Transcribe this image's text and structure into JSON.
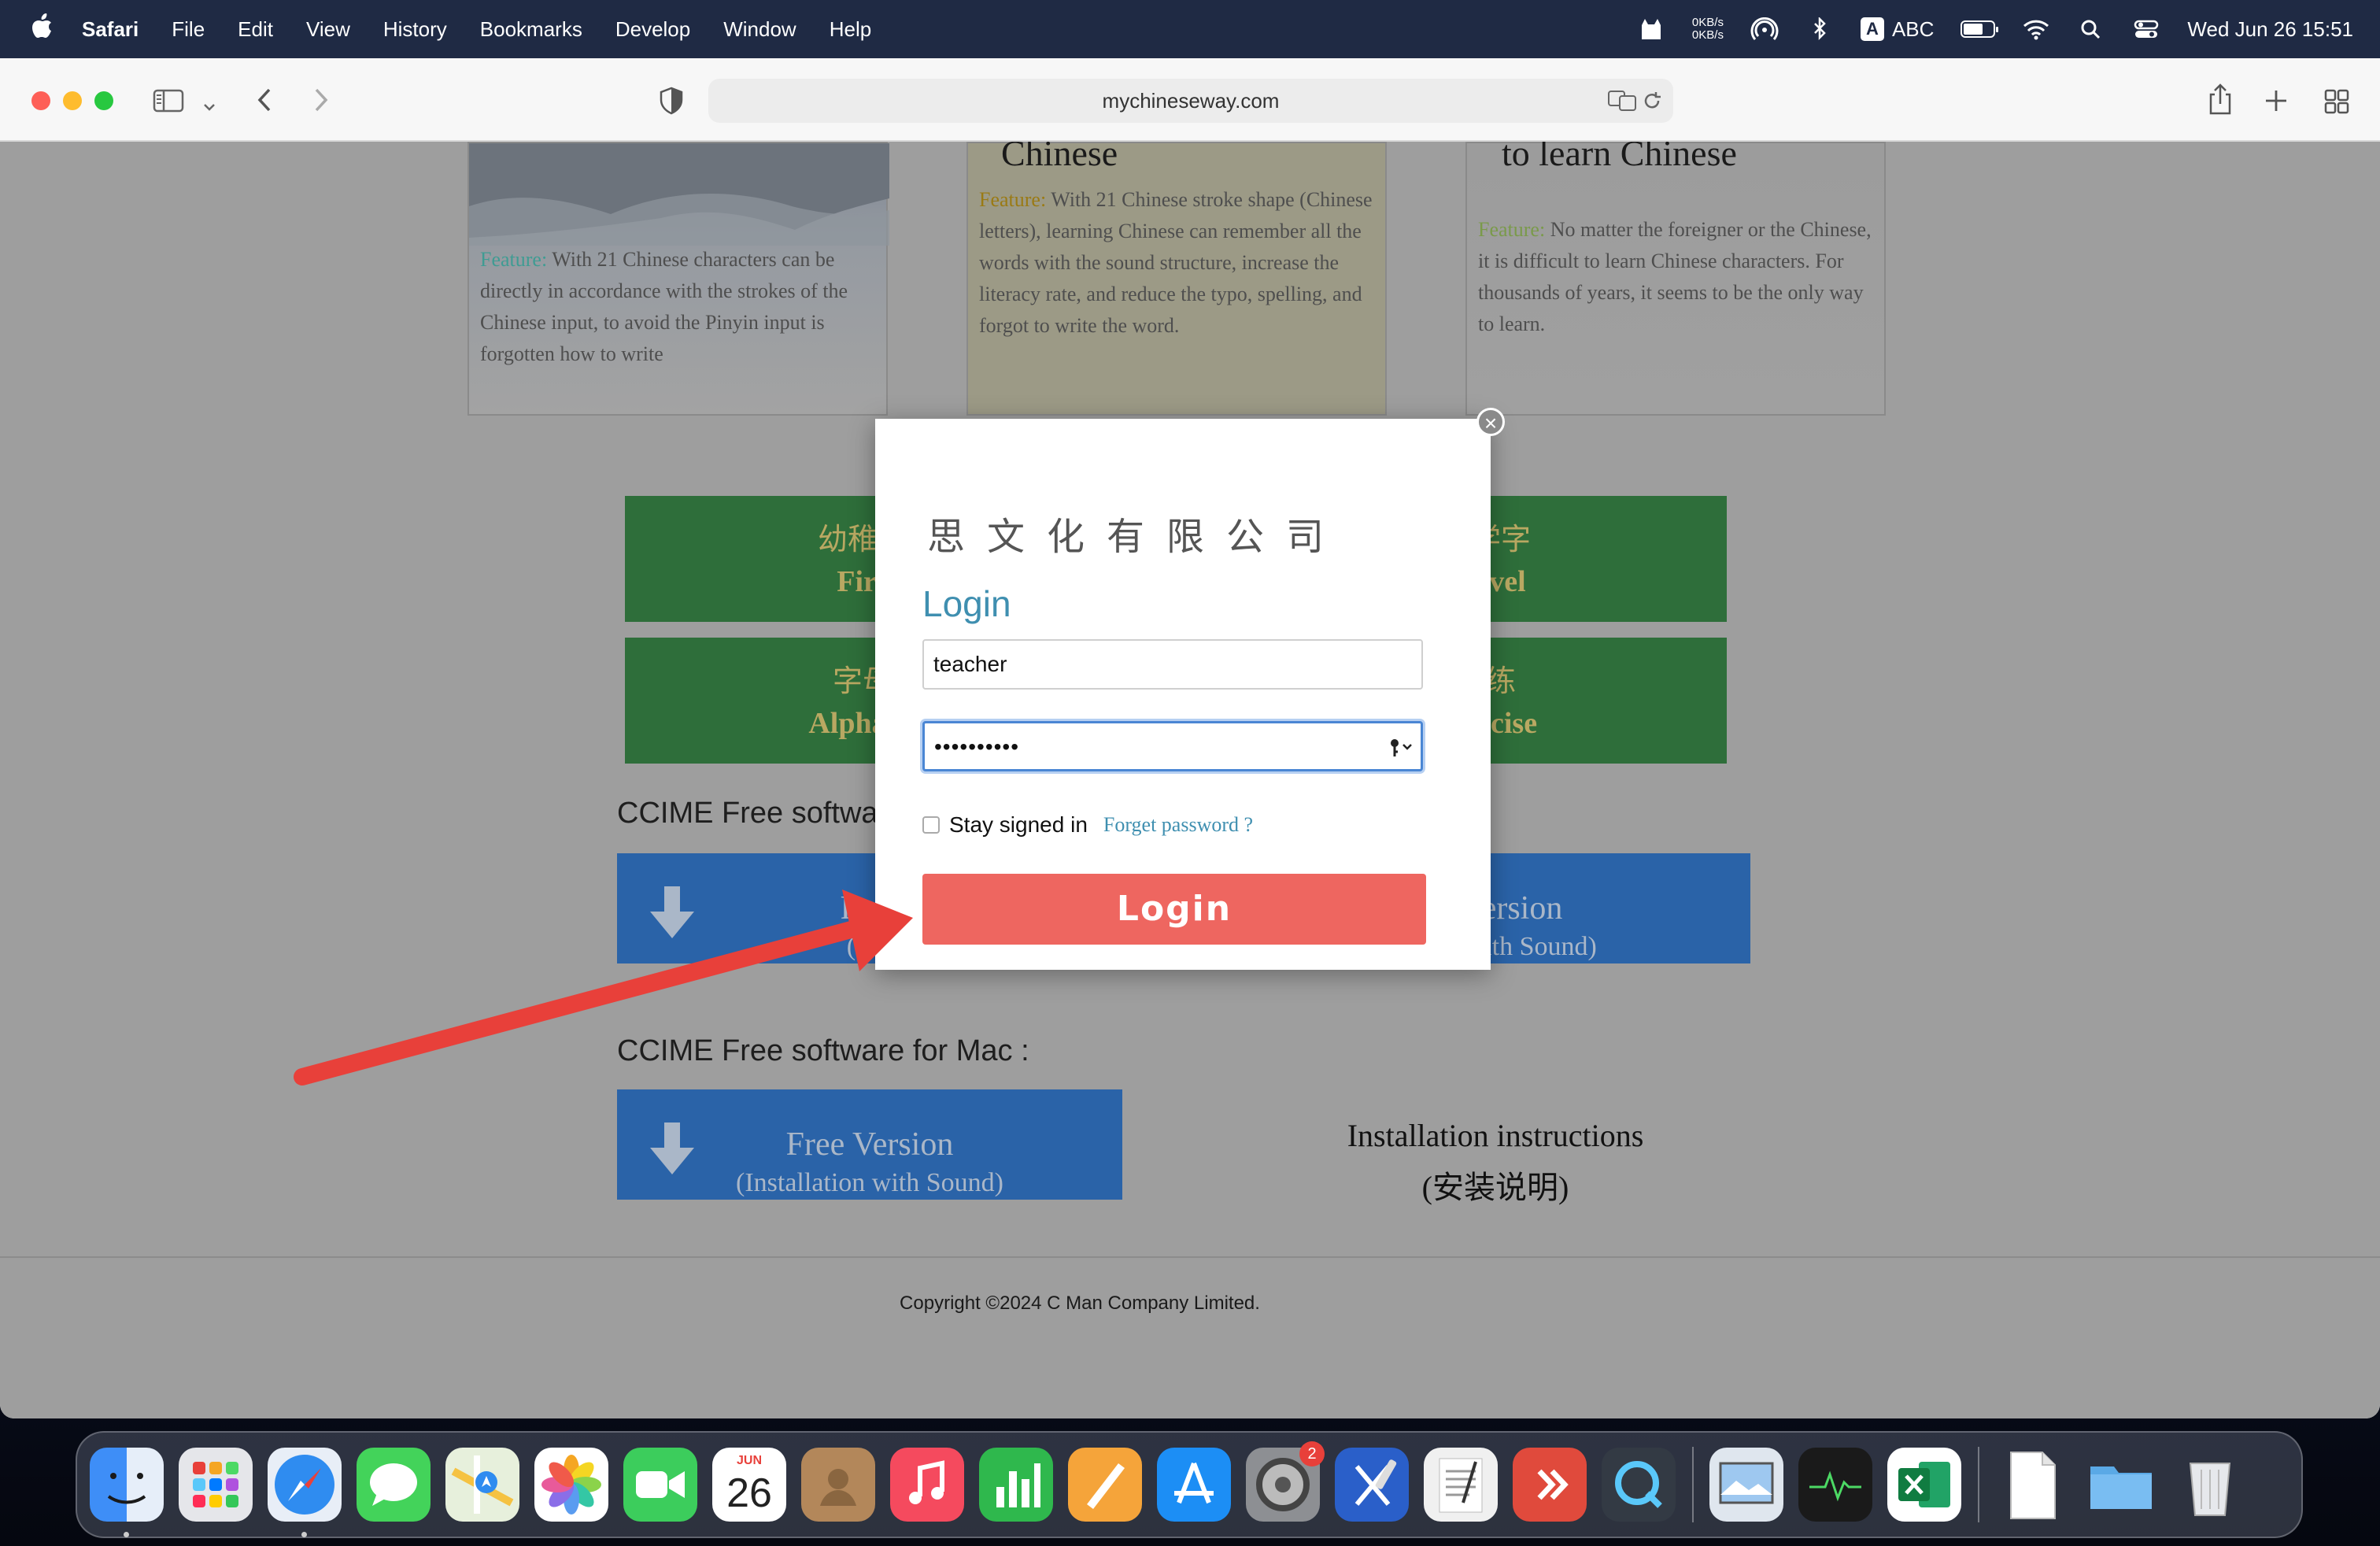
{
  "menubar": {
    "app": "Safari",
    "items": [
      "File",
      "Edit",
      "View",
      "History",
      "Bookmarks",
      "Develop",
      "Window",
      "Help"
    ],
    "net_up": "0KB/s",
    "net_down": "0KB/s",
    "input_source_letter": "A",
    "input_source": "ABC",
    "datetime": "Wed Jun 26  15:51"
  },
  "browser": {
    "url": "mychineseway.com"
  },
  "page": {
    "cards": [
      {
        "feature_label": "Feature:",
        "text": "With 21 Chinese characters can be directly in accordance with the strokes of the Chinese input, to avoid the Pinyin input is forgotten how to write"
      },
      {
        "title": "Chinese",
        "feature_label": "Feature:",
        "text": "With 21 Chinese stroke shape (Chinese letters), learning Chinese can remember all the words with the sound structure, increase the literacy rate, and reduce the typo, spelling, and forgot to write the word."
      },
      {
        "title": "to learn Chinese",
        "feature_label": "Feature:",
        "text": "No matter the foreigner or the Chinese, it is difficult to learn Chinese characters. For thousands of years, it seems to be the only way to learn."
      }
    ],
    "green_buttons": [
      {
        "line1": "幼稚园",
        "line2": "Firs"
      },
      {
        "line1": "学字",
        "line2": "evel"
      },
      {
        "line1": "字母",
        "line2": "Alphabe"
      },
      {
        "line1": "练",
        "line2": "ercise"
      }
    ],
    "section1_title": "CCIME Free softwa",
    "section1_buttons": [
      {
        "line1": "Free",
        "line2": "(Por"
      },
      {
        "line1": "e Version",
        "line2": "ation with Sound)"
      }
    ],
    "section2_title": "CCIME Free software for Mac :",
    "mac_button": {
      "line1": "Free Version",
      "line2": "(Installation with Sound)"
    },
    "install_line1": "Installation instructions",
    "install_line2": "(安装说明)",
    "copyright": "Copyright ©2024 C Man Company Limited."
  },
  "modal": {
    "close_symbol": "×",
    "company": "思文化有限公司",
    "heading": "Login",
    "username_value": "teacher",
    "password_mask": "••••••••••",
    "stay_signed_in": "Stay signed in",
    "forget_password": "Forget password ?",
    "login_button": "Login"
  },
  "dock": {
    "calendar_month": "JUN",
    "calendar_day": "26",
    "settings_badge": "2",
    "apps": [
      "finder-icon",
      "launchpad-icon",
      "safari-icon",
      "messages-icon",
      "maps-icon",
      "photos-icon",
      "facetime-icon",
      "calendar-icon",
      "contacts-icon",
      "music-icon",
      "numbers-icon",
      "pages-icon",
      "app-store-icon",
      "system-settings-icon",
      "xcode-icon",
      "textedit-icon",
      "remote-desktop-icon",
      "quicktime-icon",
      "preview-icon",
      "activity-monitor-icon",
      "excel-icon",
      "shell-script-icon",
      "folder-icon",
      "trash-icon"
    ]
  },
  "colors": {
    "login_button": "#ee6660",
    "login_heading": "#3f8fb0",
    "green_button": "#2e6e3a",
    "blue_button": "#2a63a8",
    "annotation_arrow": "#e8403a"
  }
}
